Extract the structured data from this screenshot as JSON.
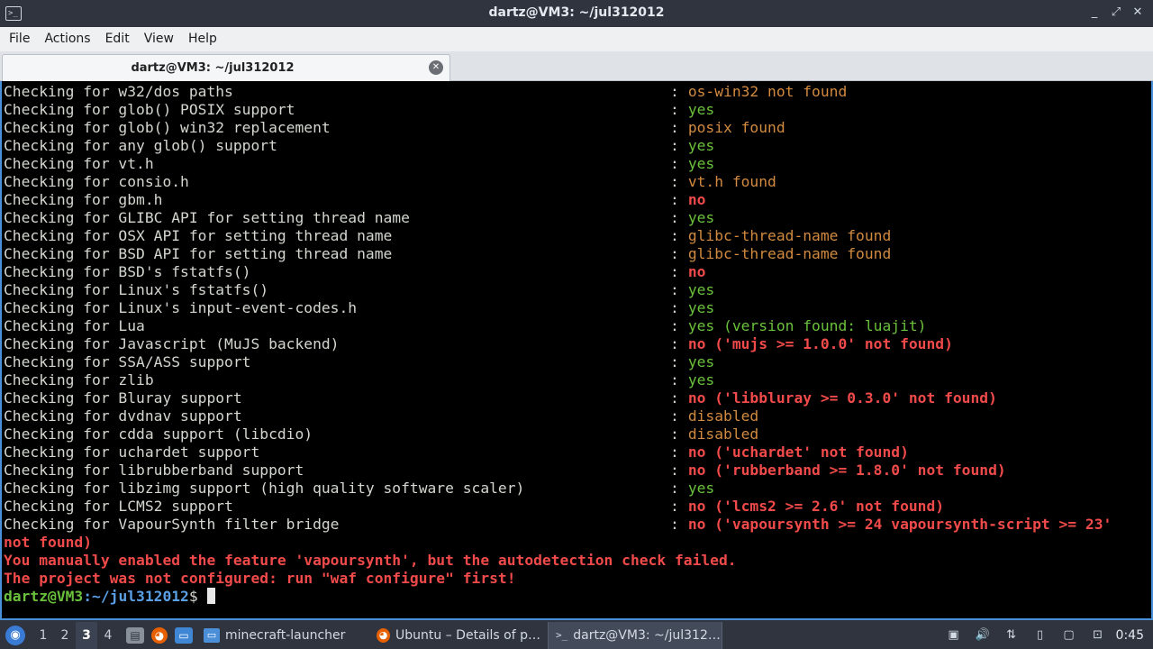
{
  "window": {
    "title": "dartz@VM3: ~/jul312012",
    "controls": [
      "_",
      "⤢",
      "✕"
    ]
  },
  "menu": [
    "File",
    "Actions",
    "Edit",
    "View",
    "Help"
  ],
  "tab": {
    "label": "dartz@VM3: ~/jul312012",
    "close": "✕"
  },
  "terminal": {
    "lines": [
      {
        "label": "Checking for w32/dos paths",
        "result": "os-win32 not found",
        "status": "orange"
      },
      {
        "label": "Checking for glob() POSIX support",
        "result": "yes",
        "status": "green"
      },
      {
        "label": "Checking for glob() win32 replacement",
        "result": "posix found",
        "status": "orange"
      },
      {
        "label": "Checking for any glob() support",
        "result": "yes",
        "status": "green"
      },
      {
        "label": "Checking for vt.h",
        "result": "yes",
        "status": "green"
      },
      {
        "label": "Checking for consio.h",
        "result": "vt.h found",
        "status": "orange"
      },
      {
        "label": "Checking for gbm.h",
        "result": "no",
        "status": "red"
      },
      {
        "label": "Checking for GLIBC API for setting thread name",
        "result": "yes",
        "status": "green"
      },
      {
        "label": "Checking for OSX API for setting thread name",
        "result": "glibc-thread-name found",
        "status": "orange"
      },
      {
        "label": "Checking for BSD API for setting thread name",
        "result": "glibc-thread-name found",
        "status": "orange"
      },
      {
        "label": "Checking for BSD's fstatfs()",
        "result": "no",
        "status": "red"
      },
      {
        "label": "Checking for Linux's fstatfs()",
        "result": "yes",
        "status": "green"
      },
      {
        "label": "Checking for Linux's input-event-codes.h",
        "result": "yes",
        "status": "green"
      },
      {
        "label": "Checking for Lua",
        "result": "yes (version found: luajit)",
        "status": "green"
      },
      {
        "label": "Checking for Javascript (MuJS backend)",
        "result": "no ('mujs >= 1.0.0' not found)",
        "status": "red"
      },
      {
        "label": "Checking for SSA/ASS support",
        "result": "yes",
        "status": "green"
      },
      {
        "label": "Checking for zlib",
        "result": "yes",
        "status": "green"
      },
      {
        "label": "Checking for Bluray support",
        "result": "no ('libbluray >= 0.3.0' not found)",
        "status": "red"
      },
      {
        "label": "Checking for dvdnav support",
        "result": "disabled",
        "status": "orange"
      },
      {
        "label": "Checking for cdda support (libcdio)",
        "result": "disabled",
        "status": "orange"
      },
      {
        "label": "Checking for uchardet support",
        "result": "no ('uchardet' not found)",
        "status": "red"
      },
      {
        "label": "Checking for librubberband support",
        "result": "no ('rubberband >= 1.8.0' not found)",
        "status": "red"
      },
      {
        "label": "Checking for libzimg support (high quality software scaler)",
        "result": "yes",
        "status": "green"
      },
      {
        "label": "Checking for LCMS2 support",
        "result": "no ('lcms2 >= 2.6' not found)",
        "status": "red"
      },
      {
        "label": "Checking for VapourSynth filter bridge",
        "result": "no ('vapoursynth >= 24 vapoursynth-script >= 23'",
        "status": "red"
      }
    ],
    "separator": ":",
    "tail": [
      "not found)",
      "You manually enabled the feature 'vapoursynth', but the autodetection check failed.",
      "The project was not configured: run \"waf configure\" first!"
    ],
    "prompt": {
      "user": "dartz@VM3",
      "path": ":~/jul312012",
      "dollar": "$"
    }
  },
  "taskbar": {
    "workspaces": [
      "1",
      "2",
      "3",
      "4"
    ],
    "active_workspace": "3",
    "tasks": [
      {
        "label": "minecraft-launcher",
        "icon": "folder-icon"
      },
      {
        "label": "Ubuntu – Details of p…",
        "icon": "firefox-icon"
      },
      {
        "label": "dartz@VM3: ~/jul312…",
        "icon": "terminal-icon"
      }
    ],
    "clock": "0:45"
  },
  "colors": {
    "green": "#6ac13b",
    "orange": "#d18a3f",
    "red": "#f04a4a",
    "prompt_path": "#5aa0e6",
    "terminal_bg": "#000000",
    "accent": "#4a90d9"
  }
}
